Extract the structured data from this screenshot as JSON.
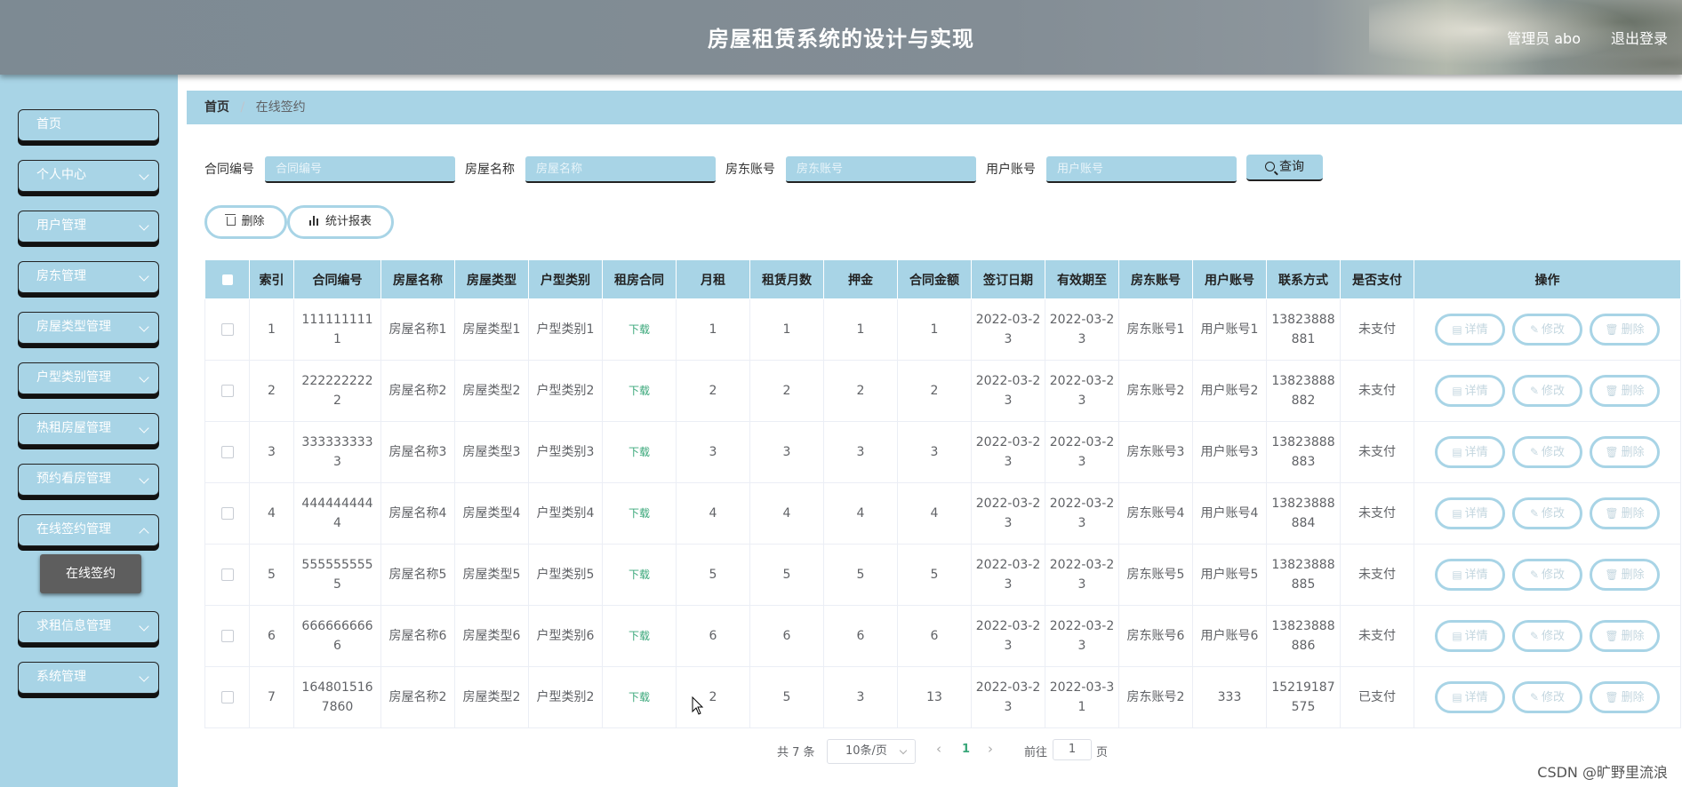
{
  "header": {
    "title": "房屋租赁系统的设计与实现",
    "user_label": "管理员 abo",
    "logout_label": "退出登录"
  },
  "sidebar": {
    "items": [
      {
        "label": "首页",
        "has_arrow": false
      },
      {
        "label": "个人中心",
        "has_arrow": true
      },
      {
        "label": "用户管理",
        "has_arrow": true
      },
      {
        "label": "房东管理",
        "has_arrow": true
      },
      {
        "label": "房屋类型管理",
        "has_arrow": true
      },
      {
        "label": "户型类别管理",
        "has_arrow": true
      },
      {
        "label": "热租房屋管理",
        "has_arrow": true
      },
      {
        "label": "预约看房管理",
        "has_arrow": true
      },
      {
        "label": "在线签约管理",
        "has_arrow": true
      },
      {
        "label": "求租信息管理",
        "has_arrow": true
      },
      {
        "label": "系统管理",
        "has_arrow": true
      }
    ],
    "active_sub": "在线签约"
  },
  "breadcrumb": {
    "home": "首页",
    "sep": "/",
    "current": "在线签约"
  },
  "search": {
    "fields": [
      {
        "label": "合同编号",
        "placeholder": "合同编号",
        "value": ""
      },
      {
        "label": "房屋名称",
        "placeholder": "房屋名称",
        "value": ""
      },
      {
        "label": "房东账号",
        "placeholder": "房东账号",
        "value": ""
      },
      {
        "label": "用户账号",
        "placeholder": "用户账号",
        "value": ""
      }
    ],
    "query_label": "查询"
  },
  "actions": {
    "delete_label": "删除",
    "report_label": "统计报表"
  },
  "table": {
    "headers": [
      "索引",
      "合同编号",
      "房屋名称",
      "房屋类型",
      "户型类别",
      "租房合同",
      "月租",
      "租赁月数",
      "押金",
      "合同金额",
      "签订日期",
      "有效期至",
      "房东账号",
      "用户账号",
      "联系方式",
      "是否支付",
      "操作"
    ],
    "rows": [
      {
        "index": "1",
        "contract_no": "1111111111",
        "house_name": "房屋名称1",
        "house_type": "房屋类型1",
        "layout": "户型类别1",
        "contract_file": "下载",
        "rent": "1",
        "months": "1",
        "deposit": "1",
        "amount": "1",
        "sign_date": "2022-03-23",
        "valid_until": "2022-03-23",
        "landlord": "房东账号1",
        "user": "用户账号1",
        "phone": "13823888881",
        "paid": "未支付"
      },
      {
        "index": "2",
        "contract_no": "2222222222",
        "house_name": "房屋名称2",
        "house_type": "房屋类型2",
        "layout": "户型类别2",
        "contract_file": "下载",
        "rent": "2",
        "months": "2",
        "deposit": "2",
        "amount": "2",
        "sign_date": "2022-03-23",
        "valid_until": "2022-03-23",
        "landlord": "房东账号2",
        "user": "用户账号2",
        "phone": "13823888882",
        "paid": "未支付"
      },
      {
        "index": "3",
        "contract_no": "3333333333",
        "house_name": "房屋名称3",
        "house_type": "房屋类型3",
        "layout": "户型类别3",
        "contract_file": "下载",
        "rent": "3",
        "months": "3",
        "deposit": "3",
        "amount": "3",
        "sign_date": "2022-03-23",
        "valid_until": "2022-03-23",
        "landlord": "房东账号3",
        "user": "用户账号3",
        "phone": "13823888883",
        "paid": "未支付"
      },
      {
        "index": "4",
        "contract_no": "4444444444",
        "house_name": "房屋名称4",
        "house_type": "房屋类型4",
        "layout": "户型类别4",
        "contract_file": "下载",
        "rent": "4",
        "months": "4",
        "deposit": "4",
        "amount": "4",
        "sign_date": "2022-03-23",
        "valid_until": "2022-03-23",
        "landlord": "房东账号4",
        "user": "用户账号4",
        "phone": "13823888884",
        "paid": "未支付"
      },
      {
        "index": "5",
        "contract_no": "5555555555",
        "house_name": "房屋名称5",
        "house_type": "房屋类型5",
        "layout": "户型类别5",
        "contract_file": "下载",
        "rent": "5",
        "months": "5",
        "deposit": "5",
        "amount": "5",
        "sign_date": "2022-03-23",
        "valid_until": "2022-03-23",
        "landlord": "房东账号5",
        "user": "用户账号5",
        "phone": "13823888885",
        "paid": "未支付"
      },
      {
        "index": "6",
        "contract_no": "6666666666",
        "house_name": "房屋名称6",
        "house_type": "房屋类型6",
        "layout": "户型类别6",
        "contract_file": "下载",
        "rent": "6",
        "months": "6",
        "deposit": "6",
        "amount": "6",
        "sign_date": "2022-03-23",
        "valid_until": "2022-03-23",
        "landlord": "房东账号6",
        "user": "用户账号6",
        "phone": "13823888886",
        "paid": "未支付"
      },
      {
        "index": "7",
        "contract_no": "1648015167860",
        "house_name": "房屋名称2",
        "house_type": "房屋类型2",
        "layout": "户型类别2",
        "contract_file": "下载",
        "rent": "2",
        "months": "5",
        "deposit": "3",
        "amount": "13",
        "sign_date": "2022-03-23",
        "valid_until": "2022-03-31",
        "landlord": "房东账号2",
        "user": "333",
        "phone": "15219187575",
        "paid": "已支付"
      }
    ],
    "row_actions": {
      "detail": "详情",
      "edit": "修改",
      "delete": "删除"
    }
  },
  "pagination": {
    "total_text": "共 7 条",
    "page_size": "10条/页",
    "current_page": "1",
    "goto_prefix": "前往",
    "goto_value": "1",
    "goto_suffix": "页"
  },
  "watermark": "CSDN @旷野里流浪",
  "colors": {
    "accent": "#a8d4e6",
    "link": "#3aa77a",
    "submenu_active": "#5e5e5e"
  }
}
